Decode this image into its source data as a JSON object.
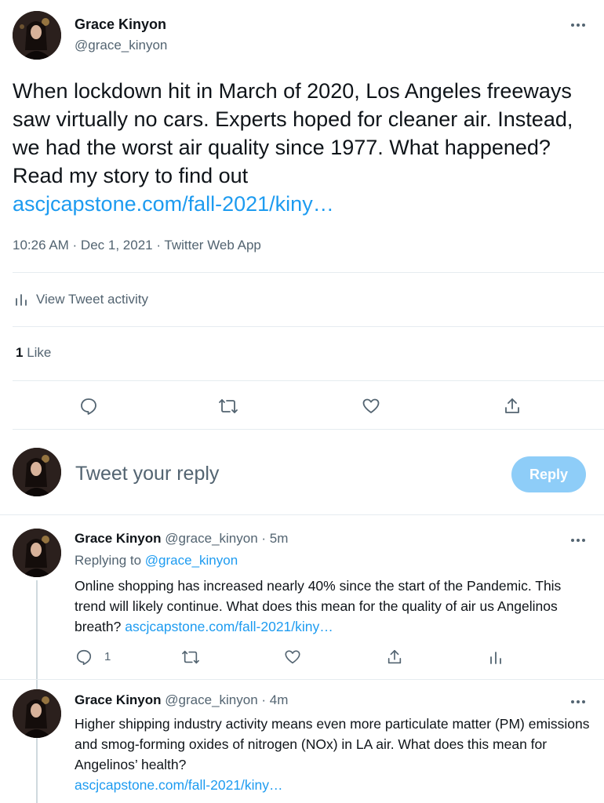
{
  "main_tweet": {
    "author_name": "Grace Kinyon",
    "handle": "@grace_kinyon",
    "text": "When lockdown hit in March of 2020, Los Angeles freeways saw virtually no cars. Experts hoped for cleaner air. Instead, we had the worst air quality since 1977. What happened? Read my story to find out",
    "link": "ascjcapstone.com/fall-2021/kiny…",
    "meta": "10:26 AM · Dec 1, 2021 · Twitter Web App",
    "activity_label": "View Tweet activity",
    "likes_count": "1",
    "likes_label": "Like"
  },
  "reply_box": {
    "placeholder": "Tweet your reply",
    "button_label": "Reply"
  },
  "replies": [
    {
      "author_name": "Grace Kinyon",
      "handle": "@grace_kinyon",
      "time": "· 5m",
      "replying_prefix": "Replying to",
      "replying_handle": "@grace_kinyon",
      "text": "Online shopping has increased nearly 40% since the start of the Pandemic. This trend will likely continue. What does this mean for the quality of air us Angelinos breath?",
      "link": "ascjcapstone.com/fall-2021/kiny…",
      "reply_count": "1"
    },
    {
      "author_name": "Grace Kinyon",
      "handle": "@grace_kinyon",
      "time": "· 4m",
      "text": "Higher shipping industry activity means even more particulate matter (PM) emissions and smog-forming oxides of nitrogen (NOx) in LA air. What does this mean for Angelinos’ health?",
      "link": "ascjcapstone.com/fall-2021/kiny…"
    }
  ],
  "colors": {
    "accent": "#1d9bf0",
    "reply_button_disabled": "#8ecdf8",
    "muted_text": "#536471",
    "divider": "#e6ecf0"
  }
}
